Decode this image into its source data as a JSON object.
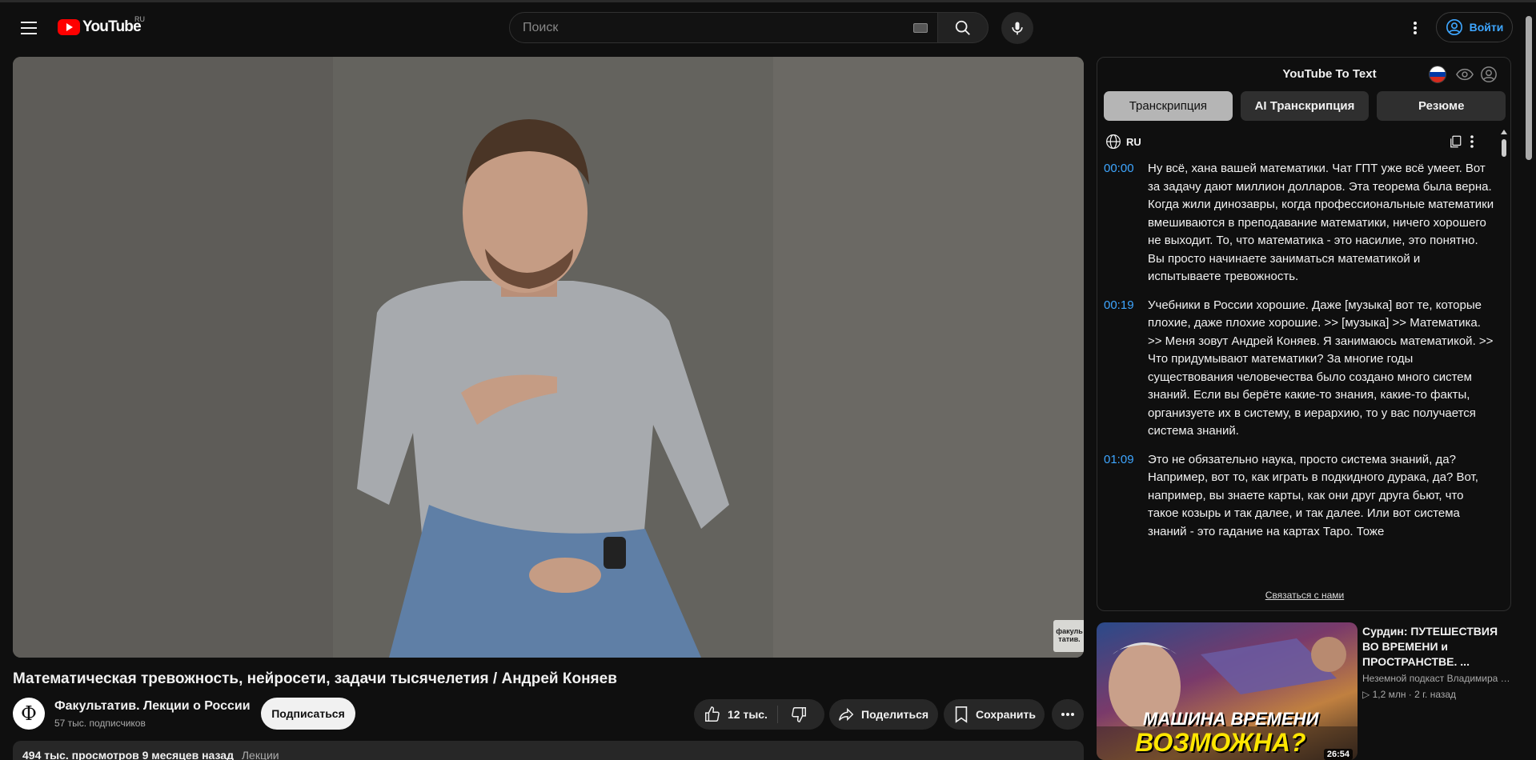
{
  "header": {
    "logo_text": "YouTube",
    "logo_region": "RU",
    "search_placeholder": "Поиск",
    "signin_label": "Войти"
  },
  "video": {
    "title": "Математическая тревожность, нейросети, задачи тысячелетия / Андрей Коняев",
    "watermark": "факуль тaтив."
  },
  "channel": {
    "avatar_letter": "Ф",
    "name": "Факультатив. Лекции о России",
    "subscribers": "57 тыс. подписчиков",
    "subscribe_label": "Подписаться"
  },
  "actions": {
    "likes": "12 тыс.",
    "share": "Поделиться",
    "save": "Сохранить"
  },
  "description": {
    "stats": "494 тыс. просмотров  9 месяцев назад",
    "tag": "Лекции"
  },
  "transcript_panel": {
    "title": "YouTube To Text",
    "tabs": [
      {
        "label": "Транскрипция",
        "active": true
      },
      {
        "label": "AI Транскрипция",
        "active": false
      },
      {
        "label": "Резюме",
        "active": false
      }
    ],
    "language": "RU",
    "segments": [
      {
        "time": "00:00",
        "text": "Ну всё, хана вашей математики. Чат ГПТ уже всё умеет. Вот за задачу дают миллион долларов. Эта теорема была верна. Когда жили динозавры, когда профессиональные математики вмешиваются в преподавание математики, ничего хорошего не выходит. То, что математика - это насилие, это понятно. Вы просто начинаете заниматься математикой и испытываете тревожность."
      },
      {
        "time": "00:19",
        "text": "Учебники в России хорошие. Даже [музыка] вот те, которые плохие, даже плохие хорошие. >> [музыка] >> Математика. >> Меня зовут Андрей Коняев. Я занимаюсь математикой. >> Что придумывают математики? За многие годы существования человечества было создано много систем знаний. Если вы берёте какие-то знания, какие-то факты, организуете их в систему, в иерархию, то у вас получается система знаний."
      },
      {
        "time": "01:09",
        "text": "Это не обязательно наука, просто система знаний, да? Например, вот то, как играть в подкидного дурака, да? Вот, например, вы знаете карты, как они друг друга бьют, что такое козырь и так далее, и так далее. Или вот система знаний - это гадание на картах Таро. Тоже"
      }
    ],
    "contact_link": "Связаться с нами"
  },
  "recommendation": {
    "thumb_line1": "МАШИНА ВРЕМЕНИ",
    "thumb_line2": "ВОЗМОЖНА?",
    "duration": "26:54",
    "title": "Сурдин: ПУТЕШЕСТВИЯ ВО ВРЕМЕНИ и ПРОСТРАНСТВЕ. ...",
    "channel": "Неземной подкаст Владимира Сурдина",
    "meta": "1,2 млн · 2 г. назад"
  }
}
